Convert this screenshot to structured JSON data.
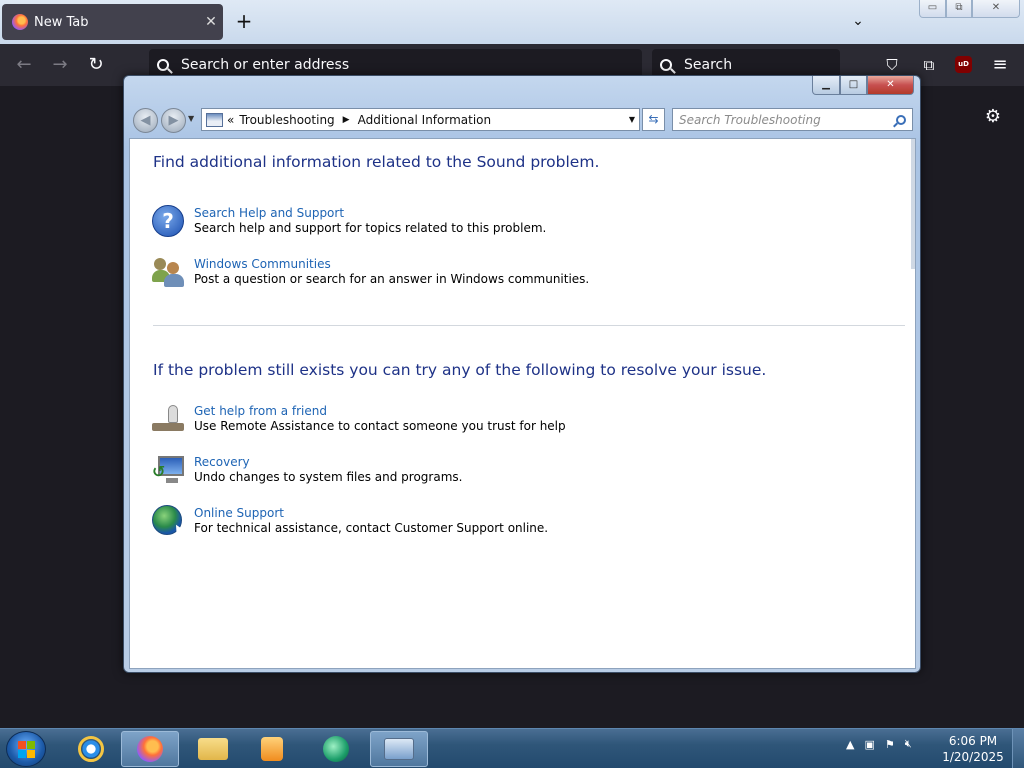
{
  "browser": {
    "tab_title": "New Tab",
    "tab_close": "✕",
    "new_tab": "+",
    "list_tabs": "⌄",
    "back": "←",
    "forward": "→",
    "reload": "↻",
    "urlbar_placeholder": "Search or enter address",
    "searchbar_placeholder": "Search",
    "pocket": "⛉",
    "extensions": "⧉",
    "ublock_label": "uD",
    "menu": "≡",
    "settings": "⚙",
    "win_minimize": "▭",
    "win_restore": "⧉",
    "win_close": "✕"
  },
  "explorer": {
    "caption_minimize": "▁",
    "caption_maximize": "□",
    "caption_close": "✕",
    "back": "◀",
    "forward": "▶",
    "address": {
      "overflow": "«",
      "crumbs": [
        "Troubleshooting",
        "Additional Information"
      ],
      "separator": "▶",
      "dropdown": "▼"
    },
    "refresh": "⇆",
    "search_placeholder": "Search Troubleshooting"
  },
  "content": {
    "section1_heading": "Find additional information related to the Sound problem.",
    "section1_items": [
      {
        "icon": "help-icon",
        "title": "Search Help and Support",
        "desc": "Search help and support for topics related to this problem."
      },
      {
        "icon": "communities-icon",
        "title": "Windows Communities",
        "desc": "Post a question or search for an answer in Windows communities."
      }
    ],
    "section2_heading": "If the problem still exists you can try any of the following to resolve your issue.",
    "section2_items": [
      {
        "icon": "remote-assistance-icon",
        "title": "Get help from a friend",
        "desc": "Use Remote Assistance to contact someone you trust for help"
      },
      {
        "icon": "recovery-icon",
        "title": "Recovery",
        "desc": "Undo changes to system files and programs."
      },
      {
        "icon": "globe-icon",
        "title": "Online Support",
        "desc": "For technical assistance, contact Customer Support online."
      }
    ]
  },
  "taskbar": {
    "tray_up": "▲",
    "clock_time": "6:06 PM",
    "clock_date": "1/20/2025"
  },
  "colors": {
    "link": "#1e64b4",
    "heading": "#1e3287",
    "browser_bg": "#1c1b22",
    "taskbar": "#2f5679"
  }
}
